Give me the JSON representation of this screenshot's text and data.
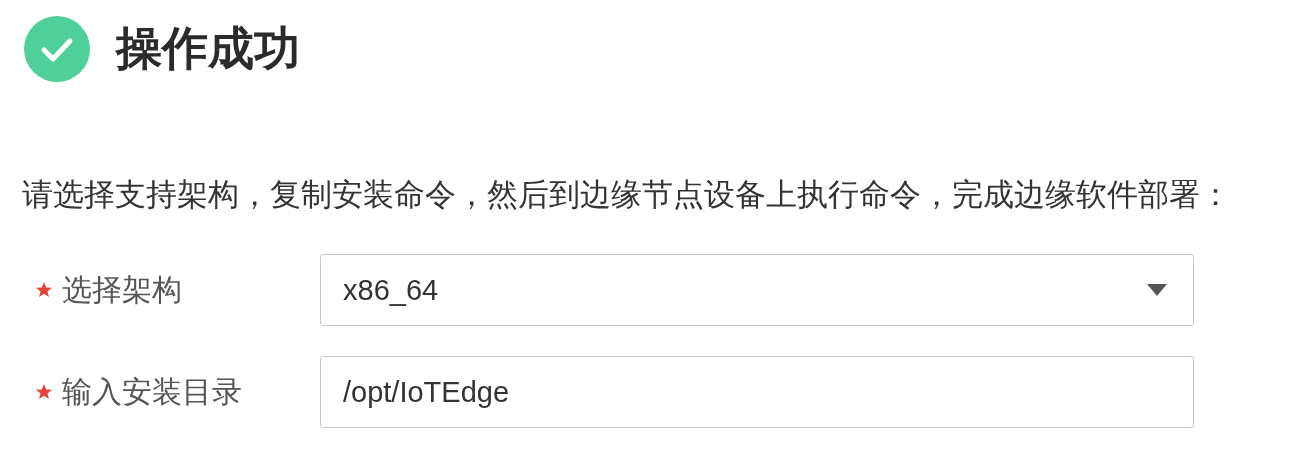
{
  "result": {
    "title": "操作成功"
  },
  "instruction": "请选择支持架构，复制安装命令，然后到边缘节点设备上执行命令，完成边缘软件部署：",
  "fields": [
    {
      "label": "选择架构",
      "required": true,
      "kind": "select",
      "value": "x86_64"
    },
    {
      "label": "输入安装目录",
      "required": true,
      "kind": "input",
      "value": "/opt/IoTEdge"
    }
  ]
}
